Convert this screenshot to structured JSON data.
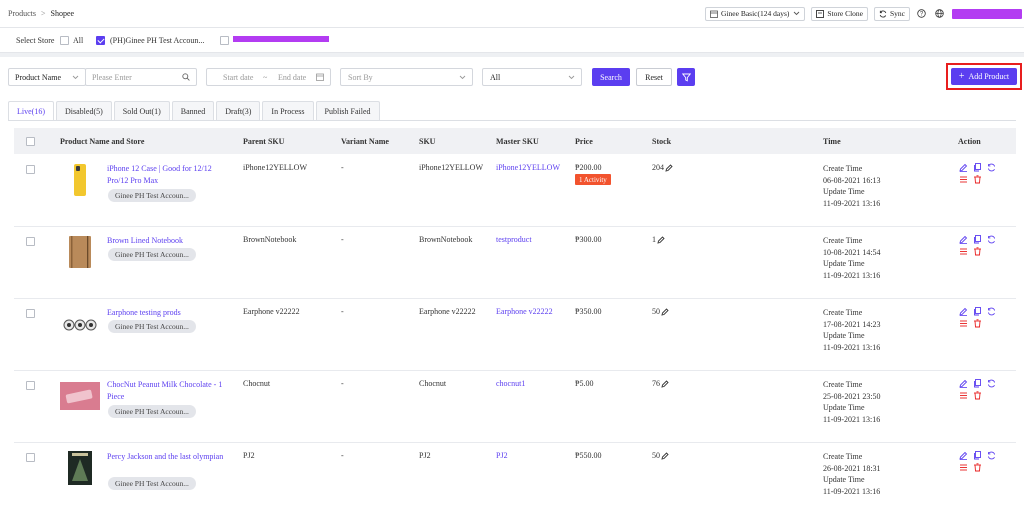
{
  "breadcrumb": {
    "parent": "Products",
    "separator": ">",
    "current": "Shopee"
  },
  "topbar": {
    "plan_label": "Ginee Basic(124 days)",
    "store_clone_label": "Store Clone",
    "sync_label": "Sync"
  },
  "store_selector": {
    "label": "Select Store",
    "all_label": "All",
    "store_label": "(PH)Ginee PH Test Accoun..."
  },
  "filters": {
    "field_select": "Product Name",
    "keyword_placeholder": "Please Enter",
    "start_date_placeholder": "Start date",
    "date_separator": "~",
    "end_date_placeholder": "End date",
    "sort_placeholder": "Sort By",
    "status_value": "All",
    "search_label": "Search",
    "reset_label": "Reset"
  },
  "add_product_label": "Add Product",
  "tabs": [
    {
      "label": "Live(16)",
      "active": true
    },
    {
      "label": "Disabled(5)"
    },
    {
      "label": "Sold Out(1)"
    },
    {
      "label": "Banned"
    },
    {
      "label": "Draft(3)"
    },
    {
      "label": "In Process"
    },
    {
      "label": "Publish Failed"
    }
  ],
  "table": {
    "columns": [
      "Product Name and Store",
      "Parent SKU",
      "Variant Name",
      "SKU",
      "Master SKU",
      "Price",
      "Stock",
      "Time",
      "Action"
    ],
    "rows": [
      {
        "name": "iPhone 12 Case | Good for 12/12 Pro/12 Pro Max",
        "store": "Ginee PH Test Accoun...",
        "parent_sku": "iPhone12YELLOW",
        "variant": "-",
        "sku": "iPhone12YELLOW",
        "master_sku": "iPhone12YELLOW",
        "price": "₱200.00",
        "activity": "1 Activity",
        "stock": "204",
        "create_label": "Create Time",
        "create_time": "06-08-2021 16:13",
        "update_label": "Update Time",
        "update_time": "11-09-2021 13:16",
        "thumb": "phone-case"
      },
      {
        "name": "Brown Lined Notebook",
        "store": "Ginee PH Test Accoun...",
        "parent_sku": "BrownNotebook",
        "variant": "-",
        "sku": "BrownNotebook",
        "master_sku": "testproduct",
        "price": "₱300.00",
        "stock": "1",
        "create_label": "Create Time",
        "create_time": "10-08-2021 14:54",
        "update_label": "Update Time",
        "update_time": "11-09-2021 13:16",
        "thumb": "notebook"
      },
      {
        "name": "Earphone testing prods",
        "store": "Ginee PH Test Accoun...",
        "parent_sku": "Earphone v22222",
        "variant": "-",
        "sku": "Earphone v22222",
        "master_sku": "Earphone v22222",
        "price": "₱350.00",
        "stock": "50",
        "create_label": "Create Time",
        "create_time": "17-08-2021 14:23",
        "update_label": "Update Time",
        "update_time": "11-09-2021 13:16",
        "thumb": "earphones"
      },
      {
        "name": "ChocNut Peanut Milk Chocolate - 1 Piece",
        "store": "Ginee PH Test Accoun...",
        "parent_sku": "Chocnut",
        "variant": "-",
        "sku": "Chocnut",
        "master_sku": "chocnut1",
        "price": "₱5.00",
        "stock": "76",
        "create_label": "Create Time",
        "create_time": "25-08-2021 23:50",
        "update_label": "Update Time",
        "update_time": "11-09-2021 13:16",
        "thumb": "chocolate"
      },
      {
        "name": "Percy Jackson and the last olympian",
        "store": "Ginee PH Test Accoun...",
        "parent_sku": "PJ2",
        "variant": "-",
        "sku": "PJ2",
        "master_sku": "PJ2",
        "price": "₱550.00",
        "stock": "50",
        "create_label": "Create Time",
        "create_time": "26-08-2021 18:31",
        "update_label": "Update Time",
        "update_time": "11-09-2021 13:16",
        "thumb": "book-cover"
      }
    ]
  },
  "colors": {
    "accent": "#5b3ef0",
    "danger": "#e81e1e",
    "activity": "#f2532e",
    "redacted": "#b33cf2"
  }
}
